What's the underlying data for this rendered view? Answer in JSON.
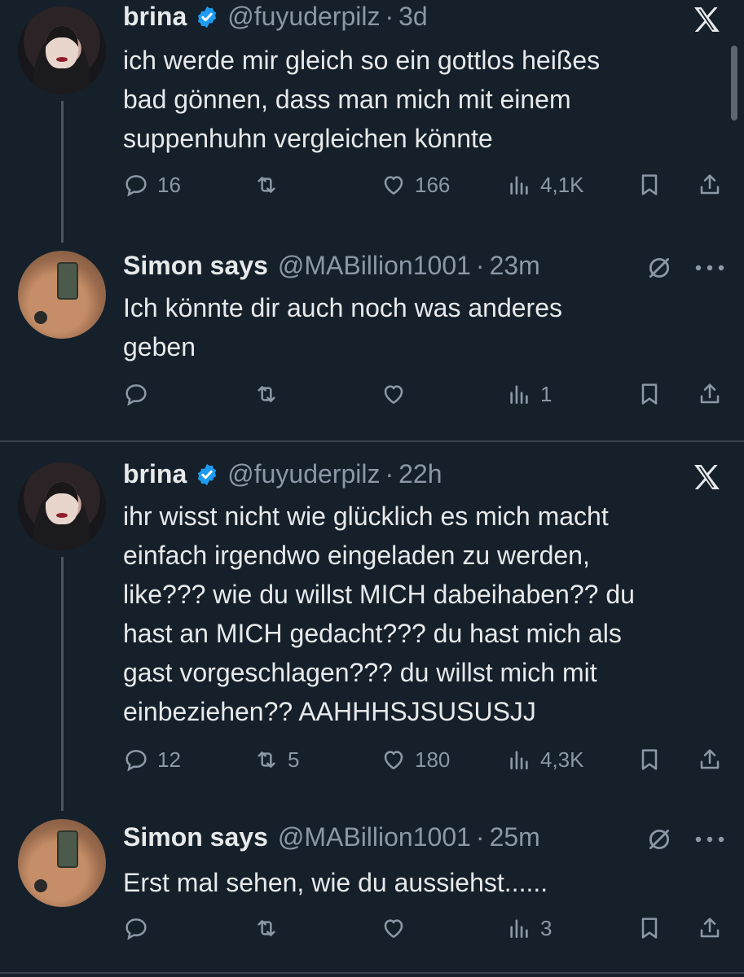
{
  "threads": [
    {
      "original": {
        "name": "brina",
        "handle": "@fuyuderpilz",
        "time": "3d",
        "text_lines": [
          "ich werde mir gleich so ein gottlos heißes",
          "bad gönnen, dass man mich mit einem",
          "suppenhuhn vergleichen könnte"
        ],
        "replies": "16",
        "retweets": "",
        "likes": "166",
        "views": "4,1K"
      },
      "reply": {
        "name": "Simon says",
        "handle": "@MABillion1001",
        "time": "23m",
        "text_lines": [
          "Ich könnte dir auch noch was anderes",
          "geben"
        ],
        "replies": "",
        "retweets": "",
        "likes": "",
        "views": "1"
      }
    },
    {
      "original": {
        "name": "brina",
        "handle": "@fuyuderpilz",
        "time": "22h",
        "text_lines": [
          "ihr wisst nicht wie glücklich es mich macht",
          "einfach irgendwo eingeladen zu werden,",
          "like??? wie du willst MICH dabeihaben?? du",
          "hast an MICH gedacht??? du hast mich als",
          "gast vorgeschlagen??? du willst mich mit",
          "einbeziehen?? AAHHHSJSUSUSJJ"
        ],
        "replies": "12",
        "retweets": "5",
        "likes": "180",
        "views": "4,3K"
      },
      "reply": {
        "name": "Simon says",
        "handle": "@MABillion1001",
        "time": "25m",
        "text_lines": [
          "Erst mal sehen, wie du aussiehst......"
        ],
        "replies": "",
        "retweets": "",
        "likes": "",
        "views": "3"
      }
    }
  ],
  "dot": "·",
  "colors": {
    "background": "#15202b",
    "text": "#e7e9ea",
    "muted": "#8b98a5",
    "verified": "#1d9bf0"
  },
  "icons": [
    "verified-badge-icon",
    "x-logo-icon",
    "no-entry-icon",
    "more-icon",
    "reply-icon",
    "retweet-icon",
    "like-icon",
    "views-icon",
    "bookmark-icon",
    "share-icon"
  ]
}
